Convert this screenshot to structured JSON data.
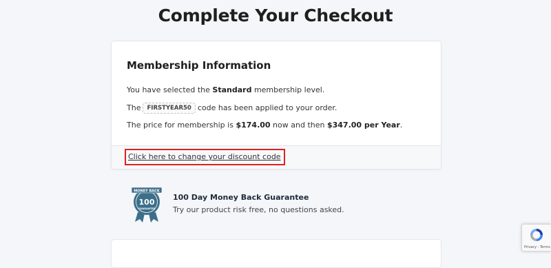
{
  "page": {
    "title": "Complete Your Checkout"
  },
  "membership": {
    "heading": "Membership Information",
    "line1_prefix": "You have selected the ",
    "level": "Standard",
    "line1_suffix": " membership level.",
    "line2_prefix": "The",
    "discount_code": "FIRSTYEAR50",
    "line2_suffix": "code has been applied to your order.",
    "line3_prefix": "The price for membership is ",
    "initial_price": "$174.00",
    "line3_middle": " now and then ",
    "recurring_price": "$347.00 per Year",
    "line3_suffix": ".",
    "change_discount_link": "Click here to change your discount code"
  },
  "guarantee": {
    "badge_top": "MONEY BACK",
    "badge_number": "100",
    "badge_bottom": "GUARANTEE",
    "title": "100 Day Money Back Guarantee",
    "text": "Try our product risk free, no questions asked."
  },
  "recaptcha": {
    "links": "Privacy - Terms"
  },
  "colors": {
    "highlight": "#e0201f",
    "badge": "#3d6f8a"
  }
}
